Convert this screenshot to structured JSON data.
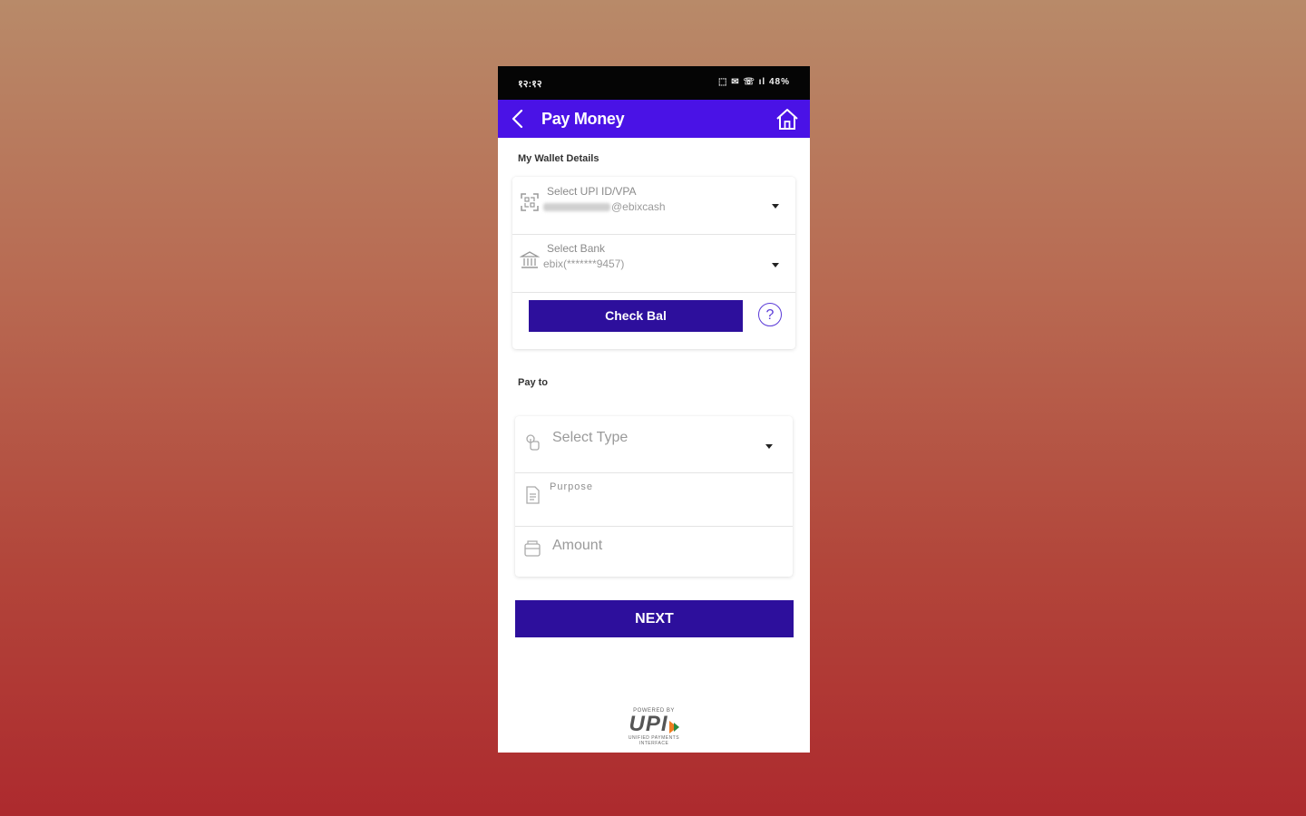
{
  "status_bar": {
    "time": "१२:१२",
    "right": "⬚ ✉ ☏ ıl 48%"
  },
  "app_bar": {
    "title": "Pay Money",
    "back_icon": "back-arrow-icon",
    "home_icon": "home-icon"
  },
  "wallet": {
    "section_label": "My Wallet Details",
    "upi": {
      "label": "Select UPI ID/VPA",
      "value_suffix": "@ebixcash"
    },
    "bank": {
      "label": "Select Bank",
      "value": "ebix(*******9457)"
    },
    "check_bal_label": "Check Bal",
    "help_glyph": "?"
  },
  "pay_to": {
    "section_label": "Pay to",
    "type_placeholder": "Select Type",
    "purpose_placeholder": "Purpose",
    "amount_placeholder": "Amount"
  },
  "next_label": "NEXT",
  "footer": {
    "powered_by": "POWERED BY",
    "logo_text": "UPI",
    "tagline": "UNIFIED PAYMENTS INTERFACE"
  },
  "colors": {
    "accent": "#4a12e6",
    "button": "#2d0f9c"
  }
}
